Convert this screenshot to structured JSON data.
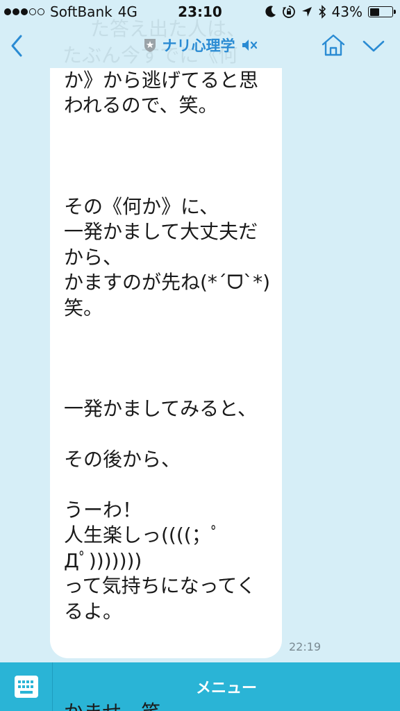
{
  "status_bar": {
    "carrier": "SoftBank",
    "network": "4G",
    "time": "23:10",
    "battery_percent": "43%",
    "battery_level": 0.43,
    "icons": [
      "signal-dots-icon",
      "moon-icon",
      "rotation-lock-icon",
      "location-arrow-icon",
      "bluetooth-icon",
      "battery-icon"
    ]
  },
  "nav": {
    "title": "ナリ心理学",
    "icons": [
      "chevron-left-icon",
      "official-badge-icon",
      "mute-icon",
      "home-icon",
      "chevron-down-icon"
    ]
  },
  "background_text": {
    "line1": "た答え出た人は、",
    "line2": "たぶん今すでに《何"
  },
  "message": {
    "text": "か》から逃げてると思\nわれるので、笑。\n\n\n\nその《何か》に、\n一発かまして大丈夫だ\nから、\nかますのが先ね(*ˊᗜˋ*)\n笑。\n\n\n\n一発かましてみると、\n\nその後から、\n\nうーわ！\n人生楽しっ((((；ﾟ\nДﾟ)))))))\nって気持ちになってく\nるよ。\n\n\n\nかませ。笑。",
    "time": "22:19"
  },
  "menu": {
    "label": "メニュー",
    "icons": [
      "keyboard-icon"
    ]
  },
  "colors": {
    "background": "#d6eef7",
    "accent": "#2a8bd3",
    "menu_bar": "#2ab4d6",
    "bubble": "#ffffff"
  }
}
